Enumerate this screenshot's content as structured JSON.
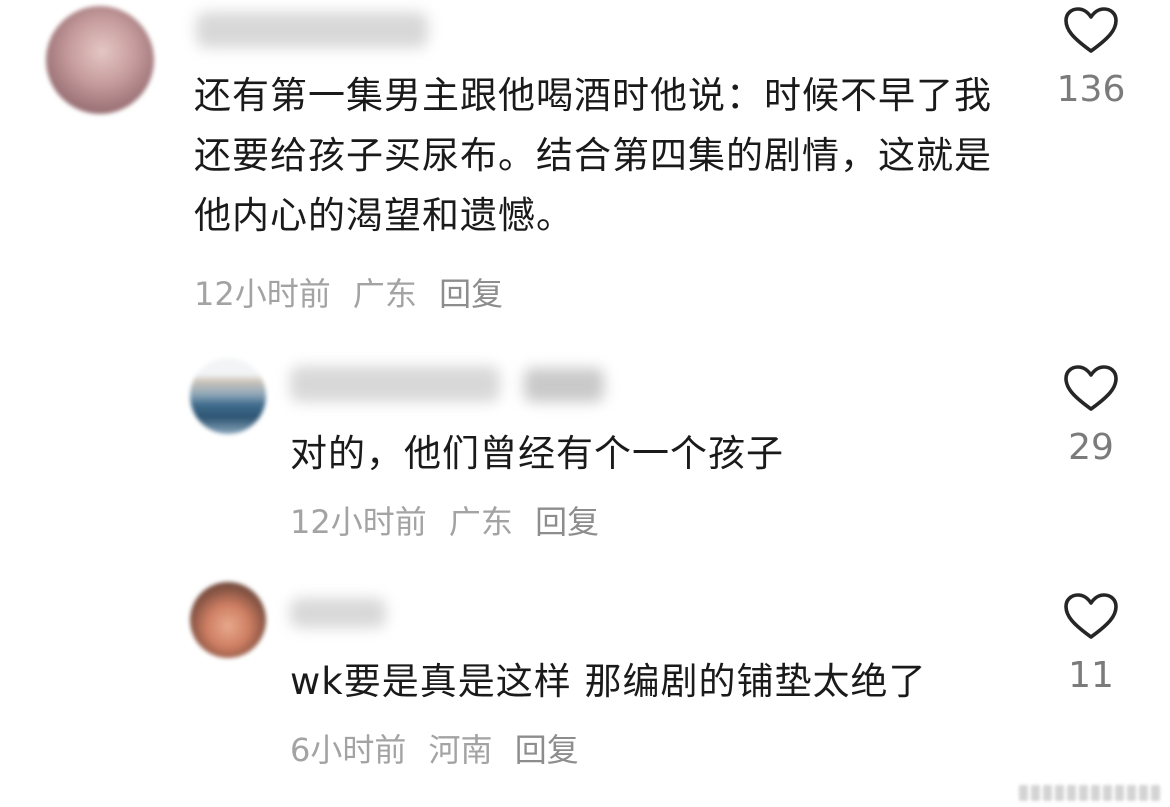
{
  "comments": [
    {
      "text": "还有第一集男主跟他喝酒时他说：时候不早了我还要给孩子买尿布。结合第四集的剧情，这就是他内心的渴望和遗憾。",
      "time": "12小时前",
      "location": "广东",
      "reply_label": "回复",
      "likes": "136"
    },
    {
      "text": "对的，他们曾经有个一个孩子",
      "time": "12小时前",
      "location": "广东",
      "reply_label": "回复",
      "likes": "29"
    },
    {
      "text": "wk要是真是这样 那编剧的铺垫太绝了",
      "time": "6小时前",
      "location": "河南",
      "reply_label": "回复",
      "likes": "11"
    }
  ],
  "icons": {
    "like": "heart-outline-icon"
  },
  "colors": {
    "text": "#1a1a1a",
    "meta": "#a3a3a3",
    "like_count": "#7b7b7b",
    "icon_stroke": "#262626"
  }
}
